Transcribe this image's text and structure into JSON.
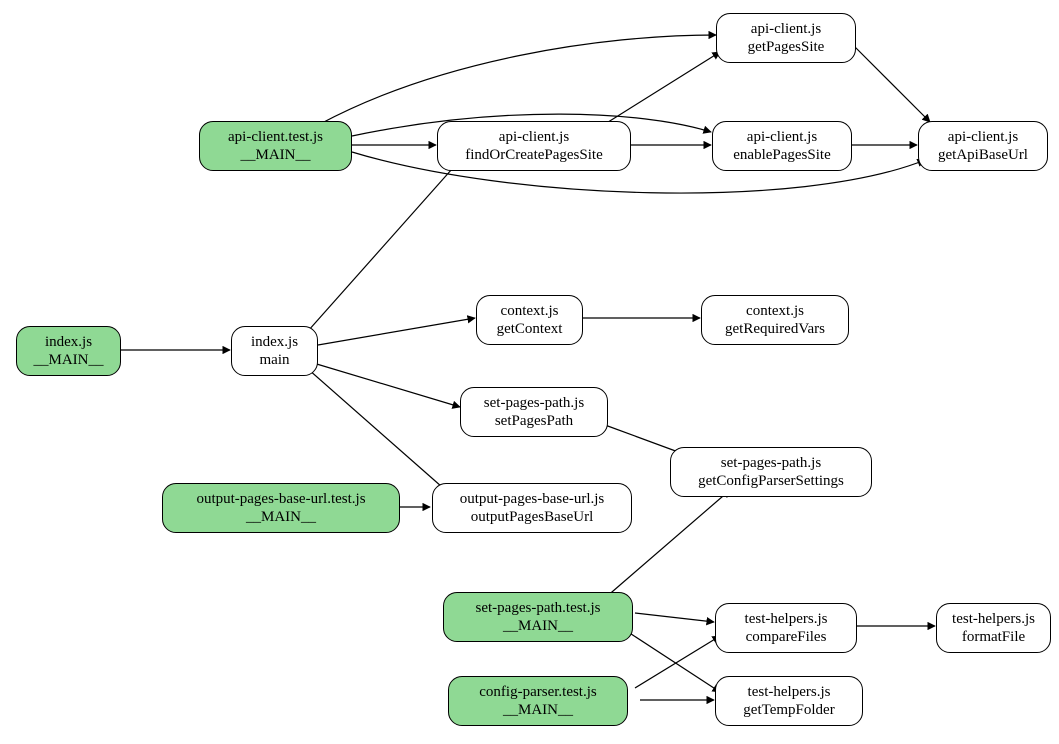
{
  "nodes": {
    "index_main_entry": {
      "line1": "index.js",
      "line2": "__MAIN__"
    },
    "index_main": {
      "line1": "index.js",
      "line2": "main"
    },
    "api_client_test": {
      "line1": "api-client.test.js",
      "line2": "__MAIN__"
    },
    "api_find_or_create": {
      "line1": "api-client.js",
      "line2": "findOrCreatePagesSite"
    },
    "api_get_pages_site": {
      "line1": "api-client.js",
      "line2": "getPagesSite"
    },
    "api_enable_pages_site": {
      "line1": "api-client.js",
      "line2": "enablePagesSite"
    },
    "api_get_base_url": {
      "line1": "api-client.js",
      "line2": "getApiBaseUrl"
    },
    "context_get": {
      "line1": "context.js",
      "line2": "getContext"
    },
    "context_required": {
      "line1": "context.js",
      "line2": "getRequiredVars"
    },
    "set_pages_path": {
      "line1": "set-pages-path.js",
      "line2": "setPagesPath"
    },
    "set_pages_config": {
      "line1": "set-pages-path.js",
      "line2": "getConfigParserSettings"
    },
    "output_base_url_test": {
      "line1": "output-pages-base-url.test.js",
      "line2": "__MAIN__"
    },
    "output_base_url": {
      "line1": "output-pages-base-url.js",
      "line2": "outputPagesBaseUrl"
    },
    "set_pages_test": {
      "line1": "set-pages-path.test.js",
      "line2": "__MAIN__"
    },
    "config_parser_test": {
      "line1": "config-parser.test.js",
      "line2": "__MAIN__"
    },
    "helpers_compare": {
      "line1": "test-helpers.js",
      "line2": "compareFiles"
    },
    "helpers_tempfolder": {
      "line1": "test-helpers.js",
      "line2": "getTempFolder"
    },
    "helpers_format": {
      "line1": "test-helpers.js",
      "line2": "formatFile"
    }
  }
}
